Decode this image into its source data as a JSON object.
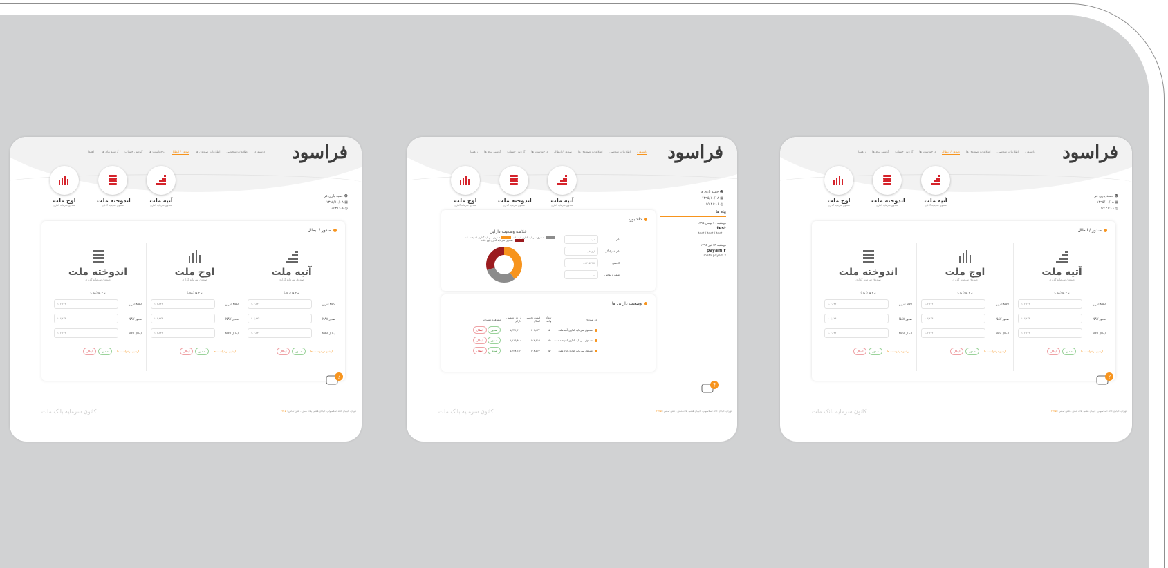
{
  "colors": {
    "background": "#d1d2d3",
    "accent": "#f7941d",
    "brand_red": "#d5232b",
    "donut": [
      "#f7941d",
      "#8c8c8c",
      "#9b1b1f"
    ]
  },
  "logo": {
    "text": "فراسود"
  },
  "nav": {
    "items": [
      "داشبورد",
      "اطلاعات شخصی",
      "اطلاعات صندوق ها",
      "صدور / ابطال",
      "درخواست ها",
      "گردش حساب",
      "آرشیو پیام ها",
      "راهنما"
    ],
    "active_index_default": 3,
    "active_index_dashboard": 0
  },
  "funds": [
    {
      "name": "آتیه ملت",
      "sub": "صندوق سرمایه گذاری",
      "icon": "stairs-chart-icon"
    },
    {
      "name": "اندوخته ملت",
      "sub": "صندوق سرمایه گذاری",
      "icon": "stack-coins-icon"
    },
    {
      "name": "اوج ملت",
      "sub": "صندوق سرمایه گذاری",
      "icon": "bar-chart-icon"
    }
  ],
  "user": {
    "name": "حمید یاری فر",
    "date": "۱۳۹۵/۱۰/۰۸",
    "time": "۱۵:۴۱:۰۶"
  },
  "issue_page": {
    "title": "صدور / ابطال",
    "price_label": "نرخ ها (ریال)",
    "rows": [
      {
        "label": "آخرین NAV",
        "value": "۱۰۶٫۶۴۲"
      },
      {
        "label": "NAV صدور",
        "value": "۱۰۶٫۸۲۴"
      },
      {
        "label": "NAV ابطال",
        "value": "۱۰۶٫۶۳۲"
      }
    ],
    "row_date": "(۱۳۹۵/۱۰/۰۸)",
    "actions": {
      "issue": "صدور",
      "cancel": "ابطال",
      "archive": "آرشیو درخواست ها"
    }
  },
  "dashboard": {
    "title": "داشبورد",
    "messages_title": "پیام ها",
    "messages": [
      {
        "date": "دوشنبه ۱۰ بهمن ۱۳۹۵",
        "title": "test",
        "body": "test / test / test ..."
      },
      {
        "date": "دوشنبه ۱۳ تیر ۱۳۹۵",
        "title": "payam ۲",
        "body": "matn payam ۲"
      }
    ],
    "summary_title": "خلاصه وضعیت دارایی",
    "legend": [
      "صندوق سرمایه گذاری آتیه ملت",
      "صندوق سرمایه گذاری اندوخته ملت",
      "صندوق سرمایه گذاری اوج ملت"
    ],
    "donut_values": [
      40,
      30,
      30
    ],
    "form": [
      {
        "label": "نام",
        "value": "حمید"
      },
      {
        "label": "نام خانوادگی",
        "value": "یاری فر"
      },
      {
        "label": "کدملی",
        "value": "۰۰۸۲۱۵۳۹۹۲"
      },
      {
        "label": "شماره تماس",
        "value": "---"
      }
    ],
    "assets_title": "وضعیت دارایی ها",
    "table": {
      "headers": [
        "نام صندوق",
        "تعداد واحد",
        "قیمت تخمینی ابطال",
        "ارزش تخمینی دارایی",
        "مشاهده عملیات"
      ],
      "rows": [
        {
          "fund": "صندوق سرمایه گذاری آتیه ملت",
          "units": "۵۰",
          "price": "۱۰۶٫۶۳۲",
          "value": "۵٫۳۳۱٫۶۰۰"
        },
        {
          "fund": "صندوق سرمایه گذاری اندوخته ملت",
          "units": "۵۰",
          "price": "۱۰۲٫۳۱۸",
          "value": "۵٫۱۱۵٫۹۰۰"
        },
        {
          "fund": "صندوق سرمایه گذاری اوج ملت",
          "units": "۵۰",
          "price": "۱۰۸٫۵۶۳",
          "value": "۵٫۴۲۸٫۱۵۰"
        }
      ],
      "issue": "صدور",
      "cancel": "ابطال"
    }
  },
  "footer": {
    "left": "کانون سرمایه بانک ملت",
    "address": "تهران، خیابان خالد اسلامبولی، خیابان هفتم، پلاک شش - تلفن تماس :",
    "phone": "۲۷۱۵"
  }
}
